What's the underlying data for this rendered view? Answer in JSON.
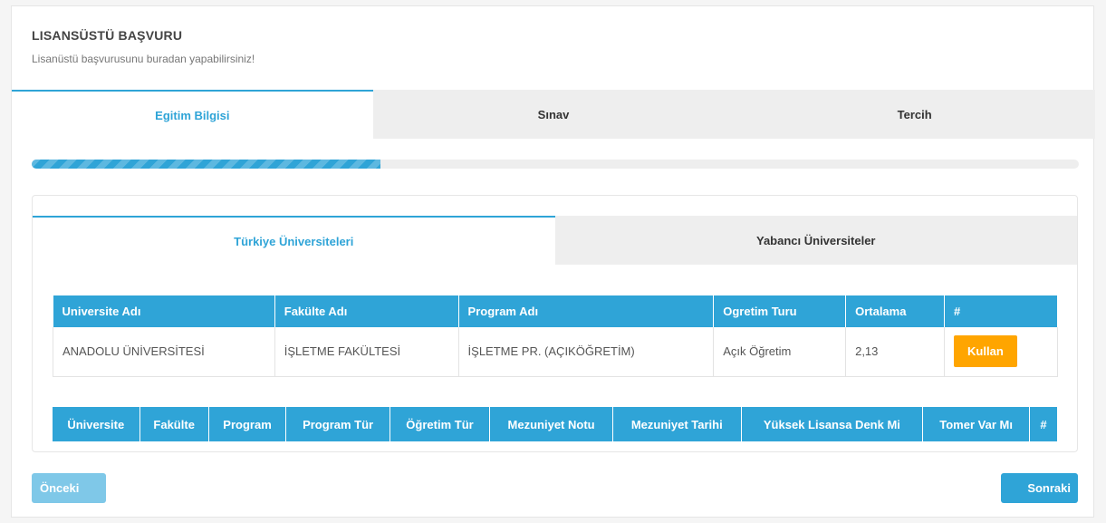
{
  "header": {
    "title": "LISANSÜSTÜ BAŞVURU",
    "subtitle": "Lisanüstü başvurusunu buradan yapabilirsiniz!"
  },
  "steps": [
    {
      "label": "Egitim Bilgisi",
      "active": true
    },
    {
      "label": "Sınav",
      "active": false
    },
    {
      "label": "Tercih",
      "active": false
    }
  ],
  "progress": {
    "fraction": 0.333
  },
  "subtabs": [
    {
      "label": "Türkiye Üniversiteleri",
      "active": true
    },
    {
      "label": "Yabancı Üniversiteler",
      "active": false
    }
  ],
  "university_table": {
    "columns": [
      "Universite Adı",
      "Fakülte Adı",
      "Program Adı",
      "Ogretim Turu",
      "Ortalama",
      "#"
    ],
    "rows": [
      {
        "universite": "ANADOLU ÜNİVERSİTESİ",
        "fakulte": "İŞLETME FAKÜLTESİ",
        "program": "İŞLETME PR. (AÇIKÖĞRETİM)",
        "ogretim": "Açık Öğretim",
        "ortalama": "2,13",
        "action": "Kullan"
      }
    ]
  },
  "selected_table": {
    "columns": [
      "Üniversite",
      "Fakülte",
      "Program",
      "Program Tür",
      "Öğretim Tür",
      "Mezuniyet Notu",
      "Mezuniyet Tarihi",
      "Yüksek Lisansa Denk Mi",
      "Tomer Var Mı",
      "#"
    ]
  },
  "footer": {
    "prev_label": "Önceki",
    "next_label": "Sonraki"
  },
  "colors": {
    "primary": "#2fa4d7",
    "accent": "#ffa500",
    "tab_inactive": "#eeeeee"
  }
}
